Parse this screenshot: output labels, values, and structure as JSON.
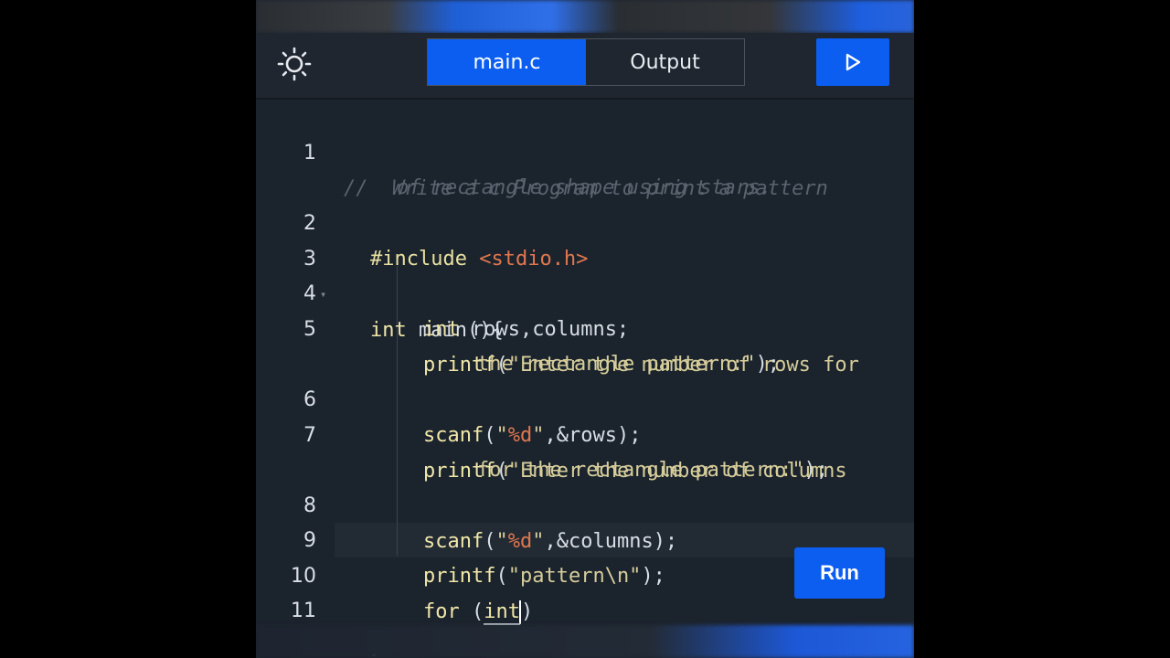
{
  "tabs": [
    {
      "label": "main.c",
      "active": true
    },
    {
      "label": "Output",
      "active": false
    }
  ],
  "toolbar": {
    "theme_icon": "sun-icon",
    "play_icon": "play-icon"
  },
  "editor": {
    "lines": [
      {
        "num": "1",
        "comment_a": "//  Write a c Program to print a pattern",
        "comment_b": "of rectangle shape using stars."
      },
      {
        "num": "2",
        "include": "#include",
        "header": "<stdio.h>"
      },
      {
        "num": "3",
        "kw": "int",
        "rest": " main(){"
      },
      {
        "num": "4",
        "kw": "int",
        "rest": " rows,columns;"
      },
      {
        "num": "5",
        "fn": "printf",
        "open": "(",
        "str_a": "\"Enter the number of rows for",
        "str_b": "the rectangle pattern:\"",
        "close": ");"
      },
      {
        "num": "6",
        "fn": "scanf",
        "open": "(",
        "q1": "\"",
        "fmt": "%d",
        "q2": "\"",
        "rest": ",&rows);"
      },
      {
        "num": "7",
        "fn": "printf",
        "open": "(",
        "str_a": "\"Enter the number of columns",
        "str_b": "for the rectangle pattern:\"",
        "close": ");"
      },
      {
        "num": "8",
        "fn": "scanf",
        "open": "(",
        "q1": "\"",
        "fmt": "%d",
        "q2": "\"",
        "rest": ",&columns);"
      },
      {
        "num": "9",
        "fn": "printf",
        "open": "(",
        "str": "\"pattern\\n\"",
        "close": ");"
      },
      {
        "num": "10",
        "kw": "for",
        "sp": " ",
        "p1": "(",
        "inner": "int",
        "p2": ")"
      },
      {
        "num": "11",
        "brace": "}"
      }
    ]
  },
  "run_button": {
    "label": "Run"
  },
  "colors": {
    "accent": "#0b5ef0",
    "background": "#1b232d",
    "keyword": "#f0e7a8",
    "format_specifier": "#e0774f",
    "comment": "#59626d"
  }
}
